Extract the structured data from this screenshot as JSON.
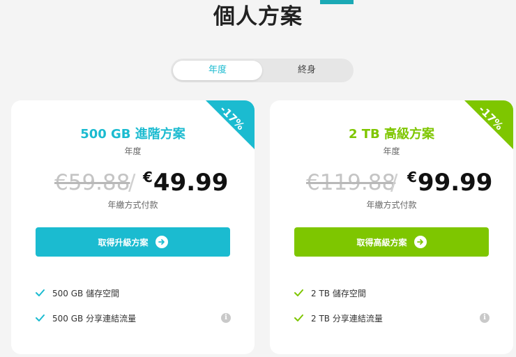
{
  "page": {
    "title": "個人方案"
  },
  "billing_toggle": {
    "options": [
      "年度",
      "終身"
    ],
    "selected": "年度"
  },
  "plans": [
    {
      "discount": "-17%",
      "name": "500 GB 進階方案",
      "period": "年度",
      "old_price": "€59.88",
      "currency": "€",
      "price": "49.99",
      "payment_note": "年繳方式付款",
      "cta": "取得升級方案",
      "features": [
        "500 GB 儲存空間",
        "500 GB 分享連結流量"
      ],
      "accent": "#1bbbd0"
    },
    {
      "discount": "-17%",
      "name": "2 TB 高級方案",
      "period": "年度",
      "old_price": "€119.88",
      "currency": "€",
      "price": "99.99",
      "payment_note": "年繳方式付款",
      "cta": "取得高級方案",
      "features": [
        "2 TB 儲存空間",
        "2 TB 分享連結流量"
      ],
      "accent": "#7ec600"
    }
  ]
}
